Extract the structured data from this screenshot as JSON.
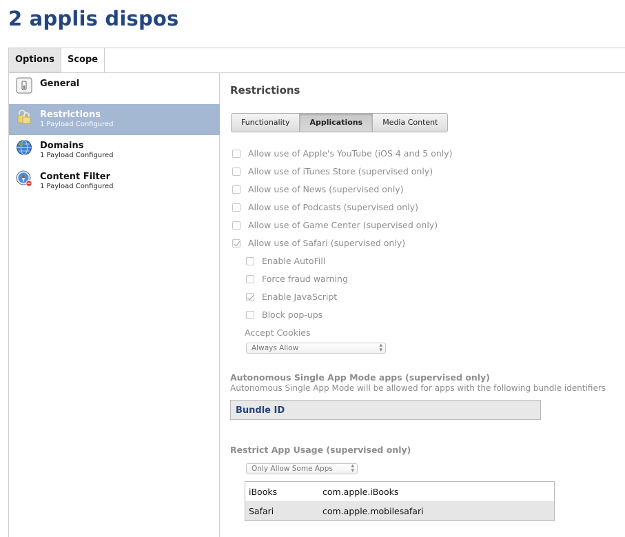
{
  "page_title": "2 applis dispos",
  "tabs": [
    {
      "label": "Options",
      "active": true
    },
    {
      "label": "Scope",
      "active": false
    }
  ],
  "sidebar": {
    "items": [
      {
        "title": "General",
        "subtitle": "",
        "icon": "switch-icon",
        "selected": false
      },
      {
        "title": "Restrictions",
        "subtitle": "1 Payload Configured",
        "icon": "locks-icon",
        "selected": true
      },
      {
        "title": "Domains",
        "subtitle": "1 Payload Configured",
        "icon": "globe-icon",
        "selected": false
      },
      {
        "title": "Content Filter",
        "subtitle": "1 Payload Configured",
        "icon": "safari-filter-icon",
        "selected": false
      }
    ]
  },
  "main": {
    "section_title": "Restrictions",
    "segments": [
      {
        "label": "Functionality",
        "active": false
      },
      {
        "label": "Applications",
        "active": true
      },
      {
        "label": "Media Content",
        "active": false
      }
    ],
    "options": [
      {
        "label": "Allow use of Apple's YouTube (iOS 4 and 5 only)",
        "checked": false
      },
      {
        "label": "Allow use of iTunes Store (supervised only)",
        "checked": false
      },
      {
        "label": "Allow use of News (supervised only)",
        "checked": false
      },
      {
        "label": "Allow use of Podcasts (supervised only)",
        "checked": false
      },
      {
        "label": "Allow use of Game Center (supervised only)",
        "checked": false
      },
      {
        "label": "Allow use of Safari (supervised only)",
        "checked": true
      }
    ],
    "safari_options": [
      {
        "label": "Enable AutoFill",
        "checked": false
      },
      {
        "label": "Force fraud warning",
        "checked": false
      },
      {
        "label": "Enable JavaScript",
        "checked": true
      },
      {
        "label": "Block pop-ups",
        "checked": false
      }
    ],
    "accept_cookies": {
      "label": "Accept Cookies",
      "value": "Always Allow"
    },
    "single_app": {
      "heading": "Autonomous Single App Mode apps (supervised only)",
      "description": "Autonomous Single App Mode will be allowed for apps with the following bundle identifiers",
      "column_header": "Bundle ID"
    },
    "restrict_usage": {
      "heading": "Restrict App Usage (supervised only)",
      "value": "Only Allow Some Apps",
      "apps": [
        {
          "name": "iBooks",
          "bundle_id": "com.apple.iBooks"
        },
        {
          "name": "Safari",
          "bundle_id": "com.apple.mobilesafari"
        }
      ]
    }
  }
}
